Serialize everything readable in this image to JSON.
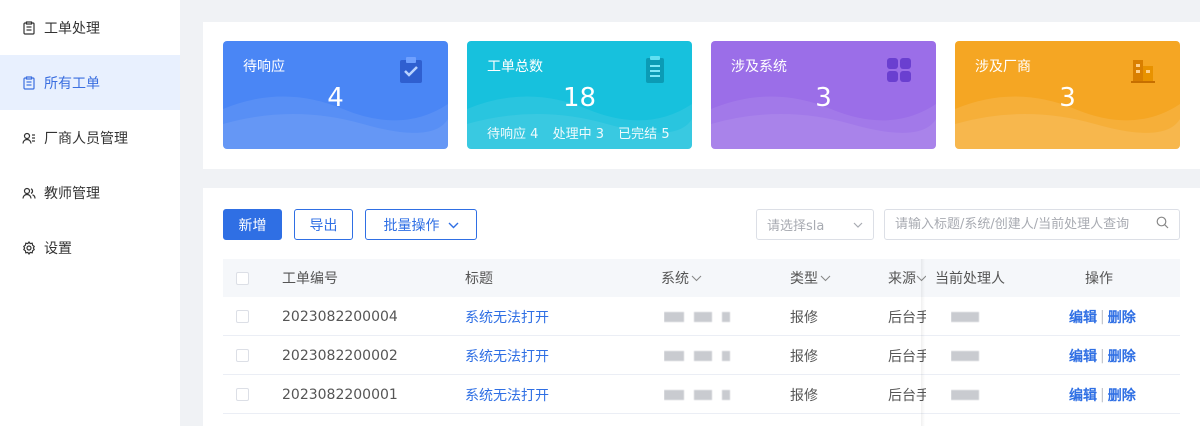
{
  "sidebar": {
    "items": [
      {
        "label": "工单处理",
        "icon": "clipboard-icon",
        "active": false
      },
      {
        "label": "所有工单",
        "icon": "clipboard-icon",
        "active": true
      },
      {
        "label": "厂商人员管理",
        "icon": "user-list-icon",
        "active": false
      },
      {
        "label": "教师管理",
        "icon": "users-icon",
        "active": false
      },
      {
        "label": "设置",
        "icon": "gear-icon",
        "active": false
      }
    ]
  },
  "stats": [
    {
      "title": "待响应",
      "value": "4",
      "icon": "clipboard-check-icon",
      "color": "#4a86f5"
    },
    {
      "title": "工单总数",
      "value": "18",
      "icon": "document-icon",
      "color": "#17c1dd",
      "sub": [
        {
          "label": "待响应",
          "value": "4"
        },
        {
          "label": "处理中",
          "value": "3"
        },
        {
          "label": "已完结",
          "value": "5"
        }
      ]
    },
    {
      "title": "涉及系统",
      "value": "3",
      "icon": "grid-icon",
      "color": "#9b6ee8"
    },
    {
      "title": "涉及厂商",
      "value": "3",
      "icon": "building-icon",
      "color": "#f5a623"
    }
  ],
  "toolbar": {
    "add_label": "新增",
    "export_label": "导出",
    "batch_label": "批量操作",
    "sla_placeholder": "请选择sla",
    "search_placeholder": "请输入标题/系统/创建人/当前处理人查询"
  },
  "table": {
    "headers": {
      "number": "工单编号",
      "title": "标题",
      "system": "系统",
      "type": "类型",
      "source": "来源",
      "handler": "当前处理人",
      "actions": "操作"
    },
    "rows": [
      {
        "number": "2023082200004",
        "title": "系统无法打开",
        "type": "报修",
        "source": "后台手"
      },
      {
        "number": "2023082200002",
        "title": "系统无法打开",
        "type": "报修",
        "source": "后台手"
      },
      {
        "number": "2023082200001",
        "title": "系统无法打开",
        "type": "报修",
        "source": "后台手"
      }
    ],
    "edit_label": "编辑",
    "delete_label": "删除",
    "separator": "|"
  }
}
